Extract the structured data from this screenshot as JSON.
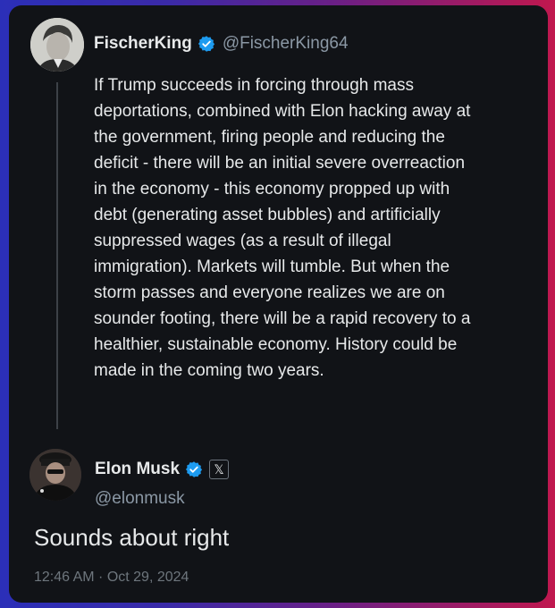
{
  "quoted_tweet": {
    "author_name": "FischerKing",
    "author_handle": "@FischerKing64",
    "verified": true,
    "text": "If Trump succeeds in forcing through mass deportations, combined with Elon hacking away at the government, firing people and reducing the deficit - there will be an initial severe overreaction in the economy - this economy propped up with debt (generating asset bubbles) and artificially suppressed wages (as a result of illegal immigration). Markets will tumble. But when the storm passes and everyone realizes we are on sounder footing, there will be a rapid recovery to a healthier, sustainable economy. History could be made in the coming two years."
  },
  "reply_tweet": {
    "author_name": "Elon Musk",
    "author_handle": "@elonmusk",
    "verified": true,
    "affiliation_badge": "X",
    "text": "Sounds about right",
    "timestamp": "12:46 AM · Oct 29, 2024"
  },
  "colors": {
    "background_left": "#2b2fb8",
    "background_right": "#c0184e",
    "card": "#111317",
    "text_primary": "#e7e9ea",
    "text_secondary": "#8b98a5",
    "verified_blue": "#1d9bf0"
  }
}
